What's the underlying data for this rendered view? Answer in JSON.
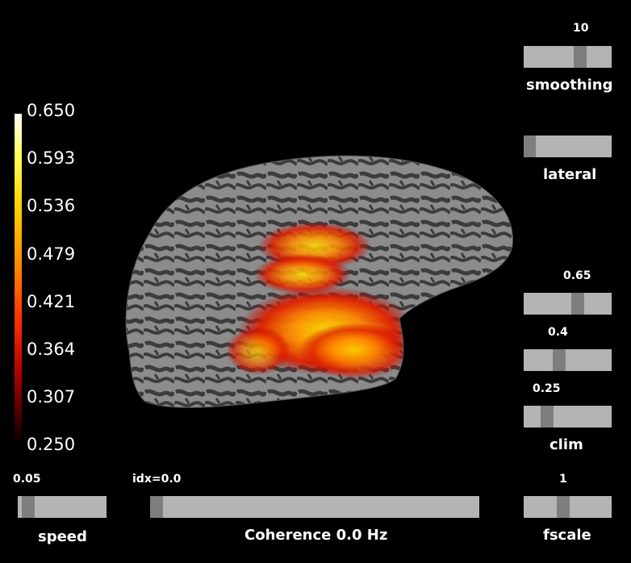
{
  "colorbar": {
    "ticks": [
      "0.650",
      "0.593",
      "0.536",
      "0.479",
      "0.421",
      "0.364",
      "0.307",
      "0.250"
    ]
  },
  "sliders": {
    "smoothing": {
      "value": "10",
      "title": "smoothing"
    },
    "lateral": {
      "title": "lateral"
    },
    "clim_high": {
      "value": "0.65"
    },
    "clim_mid": {
      "value": "0.4"
    },
    "clim_low": {
      "value": "0.25"
    },
    "clim_title": "clim",
    "speed": {
      "value": "0.05",
      "title": "speed"
    },
    "time": {
      "value": "idx=0.0",
      "title": "Coherence 0.0 Hz"
    },
    "fscale": {
      "value": "1",
      "title": "fscale"
    }
  },
  "colors": {
    "background": "#000000",
    "slider_track": "#b4b4b4",
    "slider_thumb": "#7e7e7e",
    "cortex_light": "#8c8c8c",
    "cortex_dark": "#3c3c3c"
  }
}
